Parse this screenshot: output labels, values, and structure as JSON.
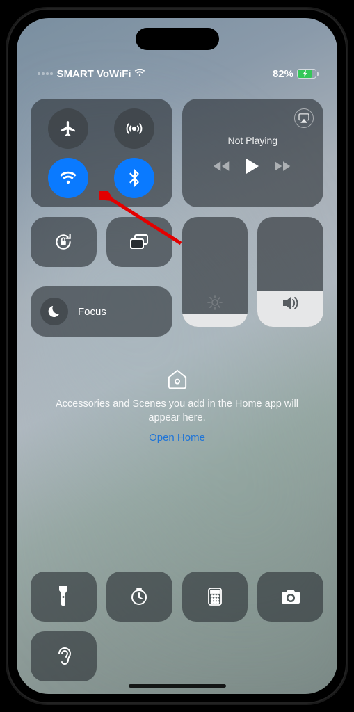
{
  "status": {
    "carrier": "SMART VoWiFi",
    "battery_percent": "82%"
  },
  "connectivity": {
    "wifi_active": true,
    "bluetooth_active": true
  },
  "media": {
    "title": "Not Playing"
  },
  "focus": {
    "label": "Focus"
  },
  "home": {
    "message": "Accessories and Scenes you add in the Home app will appear here.",
    "link": "Open Home"
  },
  "sliders": {
    "brightness": 0.12,
    "volume": 0.32
  }
}
